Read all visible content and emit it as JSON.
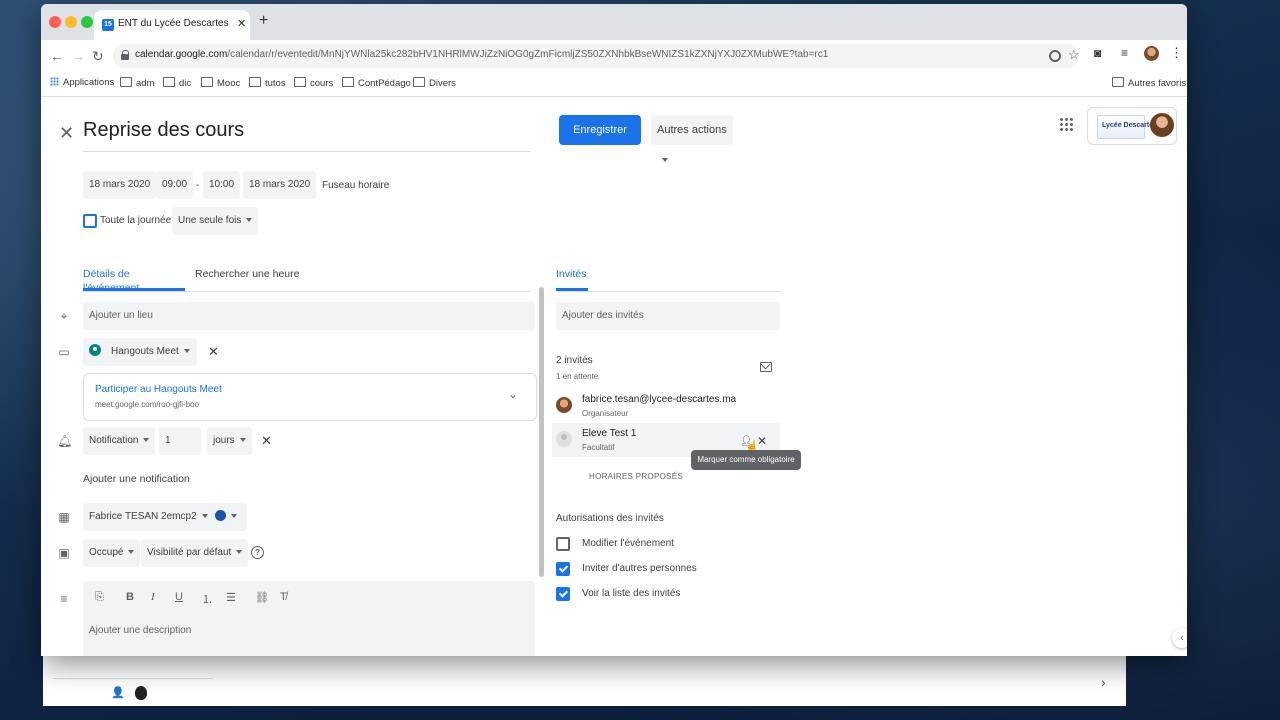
{
  "browser": {
    "tab_title": "ENT du Lycée Descartes – Agen",
    "favicon_text": "15",
    "url_domain": "calendar.google.com",
    "url_path": "/calendar/r/eventedit/MnNjYWNla25kc282bHV1NHRlMWJiZzNiOG0gZmFicmljZS50ZXNhbkBseWNIZS1kZXNjYXJ0ZXMubWE?tab=rc1",
    "bookmarks": [
      "Applications",
      "adm",
      "dic",
      "Mooc",
      "tutos",
      "cours",
      "ContPédago",
      "Divers"
    ],
    "other_bookmarks": "Autres favoris"
  },
  "event": {
    "title": "Reprise des cours",
    "save_label": "Enregistrer",
    "more_actions_label": "Autres actions",
    "start_date": "18 mars 2020",
    "start_time": "09:00",
    "dash": "-",
    "end_time": "10:00",
    "end_date": "18 mars 2020",
    "timezone_label": "Fuseau horaire",
    "all_day_label": "Toute la journée",
    "repeat_label": "Une seule fois"
  },
  "brand": {
    "logo_text": "Lycée Descartes"
  },
  "left_tabs": {
    "details": "Détails de l'événement",
    "find_time": "Rechercher une heure"
  },
  "details": {
    "location_placeholder": "Ajouter un lieu",
    "conference_label": "Hangouts Meet",
    "meet_join_label": "Participer au Hangouts Meet",
    "meet_link": "meet.google.com/roo-gjfi-boo",
    "notification_type": "Notification",
    "notification_value": "1",
    "notification_unit": "jours",
    "add_notification": "Ajouter une notification",
    "calendar_owner": "Fabrice TESAN 2emcp2",
    "event_color": "#1a54a8",
    "busy_label": "Occupé",
    "visibility_label": "Visibilité par défaut",
    "description_placeholder": "Ajouter une description"
  },
  "guests": {
    "tab_label": "Invités",
    "input_placeholder": "Ajouter des invités",
    "count_label": "2 invités",
    "pending_label": "1 en attente",
    "list": [
      {
        "name": "fabrice.tesan@lycee-descartes.ma",
        "role": "Organisateur"
      },
      {
        "name": "Eleve Test 1",
        "role": "Facultatif"
      }
    ],
    "tooltip": "Marquer comme obligatoire",
    "proposed_times": "HORAIRES PROPOSÉS",
    "permissions_title": "Autorisations des invités",
    "permissions": [
      {
        "label": "Modifier l'événement",
        "checked": false
      },
      {
        "label": "Inviter d'autres personnes",
        "checked": true
      },
      {
        "label": "Voir la liste des invités",
        "checked": true
      }
    ]
  }
}
